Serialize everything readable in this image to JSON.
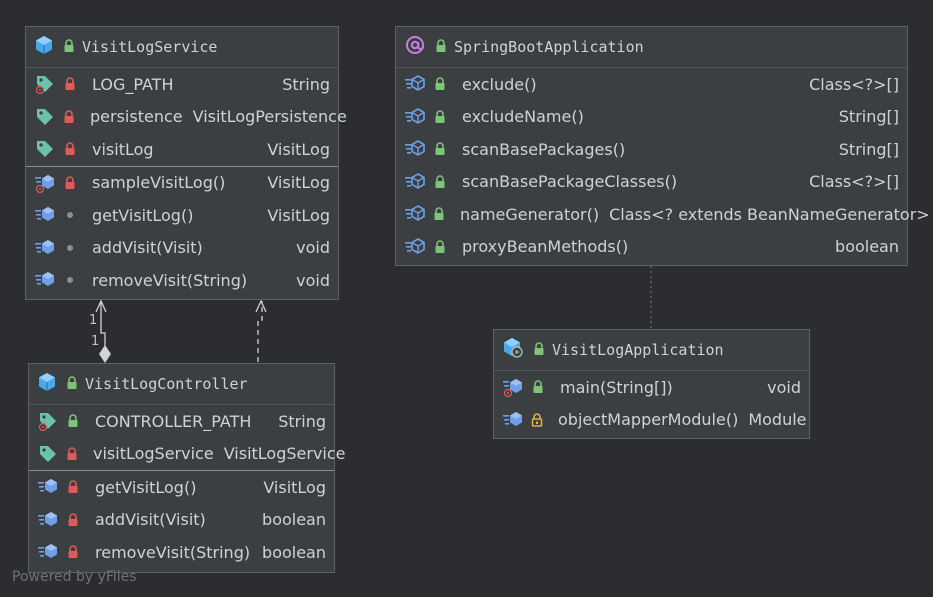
{
  "colors": {
    "background": "#2b2d30",
    "node_fill": "#3c3f41",
    "lock_private": "#e05a5a",
    "lock_public": "#7ec476",
    "lock_protected": "#e0b23e",
    "class_icon": "#4aa8e8",
    "method_icon": "#6f9fe8",
    "field_icon": "#69c2a9",
    "annotation_icon": "#c77de0"
  },
  "nodes": {
    "visitLogService": {
      "title": "VisitLogService",
      "icon": "class-icon",
      "fields": [
        {
          "name": "LOG_PATH",
          "type": "String",
          "visibility": "private",
          "static": true
        },
        {
          "name": "persistence",
          "type": "VisitLogPersistence",
          "visibility": "private",
          "static": false
        },
        {
          "name": "visitLog",
          "type": "VisitLog",
          "visibility": "private",
          "static": false
        }
      ],
      "methods": [
        {
          "name": "sampleVisitLog()",
          "type": "VisitLog",
          "visibility": "private",
          "static": true
        },
        {
          "name": "getVisitLog()",
          "type": "VisitLog",
          "visibility": "package",
          "static": false
        },
        {
          "name": "addVisit(Visit)",
          "type": "void",
          "visibility": "package",
          "static": false
        },
        {
          "name": "removeVisit(String)",
          "type": "void",
          "visibility": "package",
          "static": false
        }
      ]
    },
    "springBootApplication": {
      "title": "SpringBootApplication",
      "icon": "annotation-icon",
      "methods": [
        {
          "name": "exclude()",
          "type": "Class<?>[]",
          "visibility": "public"
        },
        {
          "name": "excludeName()",
          "type": "String[]",
          "visibility": "public"
        },
        {
          "name": "scanBasePackages()",
          "type": "String[]",
          "visibility": "public"
        },
        {
          "name": "scanBasePackageClasses()",
          "type": "Class<?>[]",
          "visibility": "public"
        },
        {
          "name": "nameGenerator()",
          "type": "Class<? extends BeanNameGenerator>",
          "visibility": "public"
        },
        {
          "name": "proxyBeanMethods()",
          "type": "boolean",
          "visibility": "public"
        }
      ]
    },
    "visitLogController": {
      "title": "VisitLogController",
      "icon": "class-icon",
      "fields": [
        {
          "name": "CONTROLLER_PATH",
          "type": "String",
          "visibility": "public",
          "static": true
        },
        {
          "name": "visitLogService",
          "type": "VisitLogService",
          "visibility": "private",
          "static": false
        }
      ],
      "methods": [
        {
          "name": "getVisitLog()",
          "type": "VisitLog",
          "visibility": "private",
          "static": false
        },
        {
          "name": "addVisit(Visit)",
          "type": "boolean",
          "visibility": "private",
          "static": false
        },
        {
          "name": "removeVisit(String)",
          "type": "boolean",
          "visibility": "private",
          "static": false
        }
      ]
    },
    "visitLogApplication": {
      "title": "VisitLogApplication",
      "icon": "application-class-icon",
      "methods": [
        {
          "name": "main(String[])",
          "type": "void",
          "visibility": "public",
          "static": true
        },
        {
          "name": "objectMapperModule()",
          "type": "Module",
          "visibility": "protected",
          "static": false
        }
      ]
    }
  },
  "edges": {
    "composition_labels": [
      "1",
      "1"
    ]
  },
  "watermark": "Powered by yFiles"
}
